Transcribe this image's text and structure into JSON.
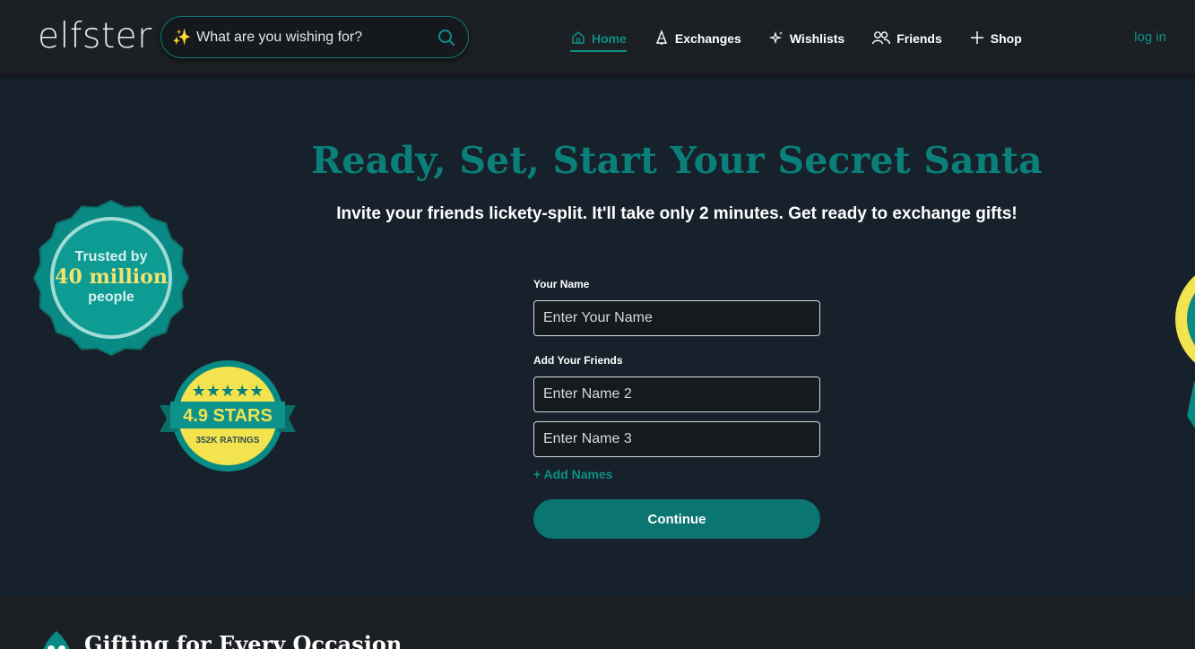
{
  "header": {
    "logo": "elfster",
    "search": {
      "placeholder": "What are you wishing for?",
      "sparkle_icon": "✨"
    },
    "nav": [
      {
        "label": "Home",
        "icon": "home-icon",
        "active": true
      },
      {
        "label": "Exchanges",
        "icon": "tree-icon",
        "active": false
      },
      {
        "label": "Wishlists",
        "icon": "sparkles-icon",
        "active": false
      },
      {
        "label": "Friends",
        "icon": "users-icon",
        "active": false
      },
      {
        "label": "Shop",
        "icon": "plus-icon",
        "active": false
      }
    ],
    "login": "log in"
  },
  "hero": {
    "title": "Ready, Set, Start Your Secret Santa",
    "subtitle": "Invite your friends lickety-split. It'll take only 2 minutes. Get ready to exchange gifts!"
  },
  "badges": {
    "trusted": {
      "line1": "Trusted by",
      "line2": "40 million",
      "line3": "people"
    },
    "rating": {
      "stars": "★★★★★",
      "value": "4.9 STARS",
      "count": "352K RATINGS"
    }
  },
  "form": {
    "your_name_label": "Your Name",
    "your_name_placeholder": "Enter Your Name",
    "friends_label": "Add Your Friends",
    "friend_placeholders": [
      "Enter Name 2",
      "Enter Name 3"
    ],
    "add_names": "+ Add Names",
    "continue": "Continue"
  },
  "footer": {
    "title": "Gifting for Every Occasion"
  },
  "colors": {
    "teal": "#0b7f79",
    "background": "#17212c",
    "header": "#1c1f23",
    "yellow": "#f2e34f"
  }
}
